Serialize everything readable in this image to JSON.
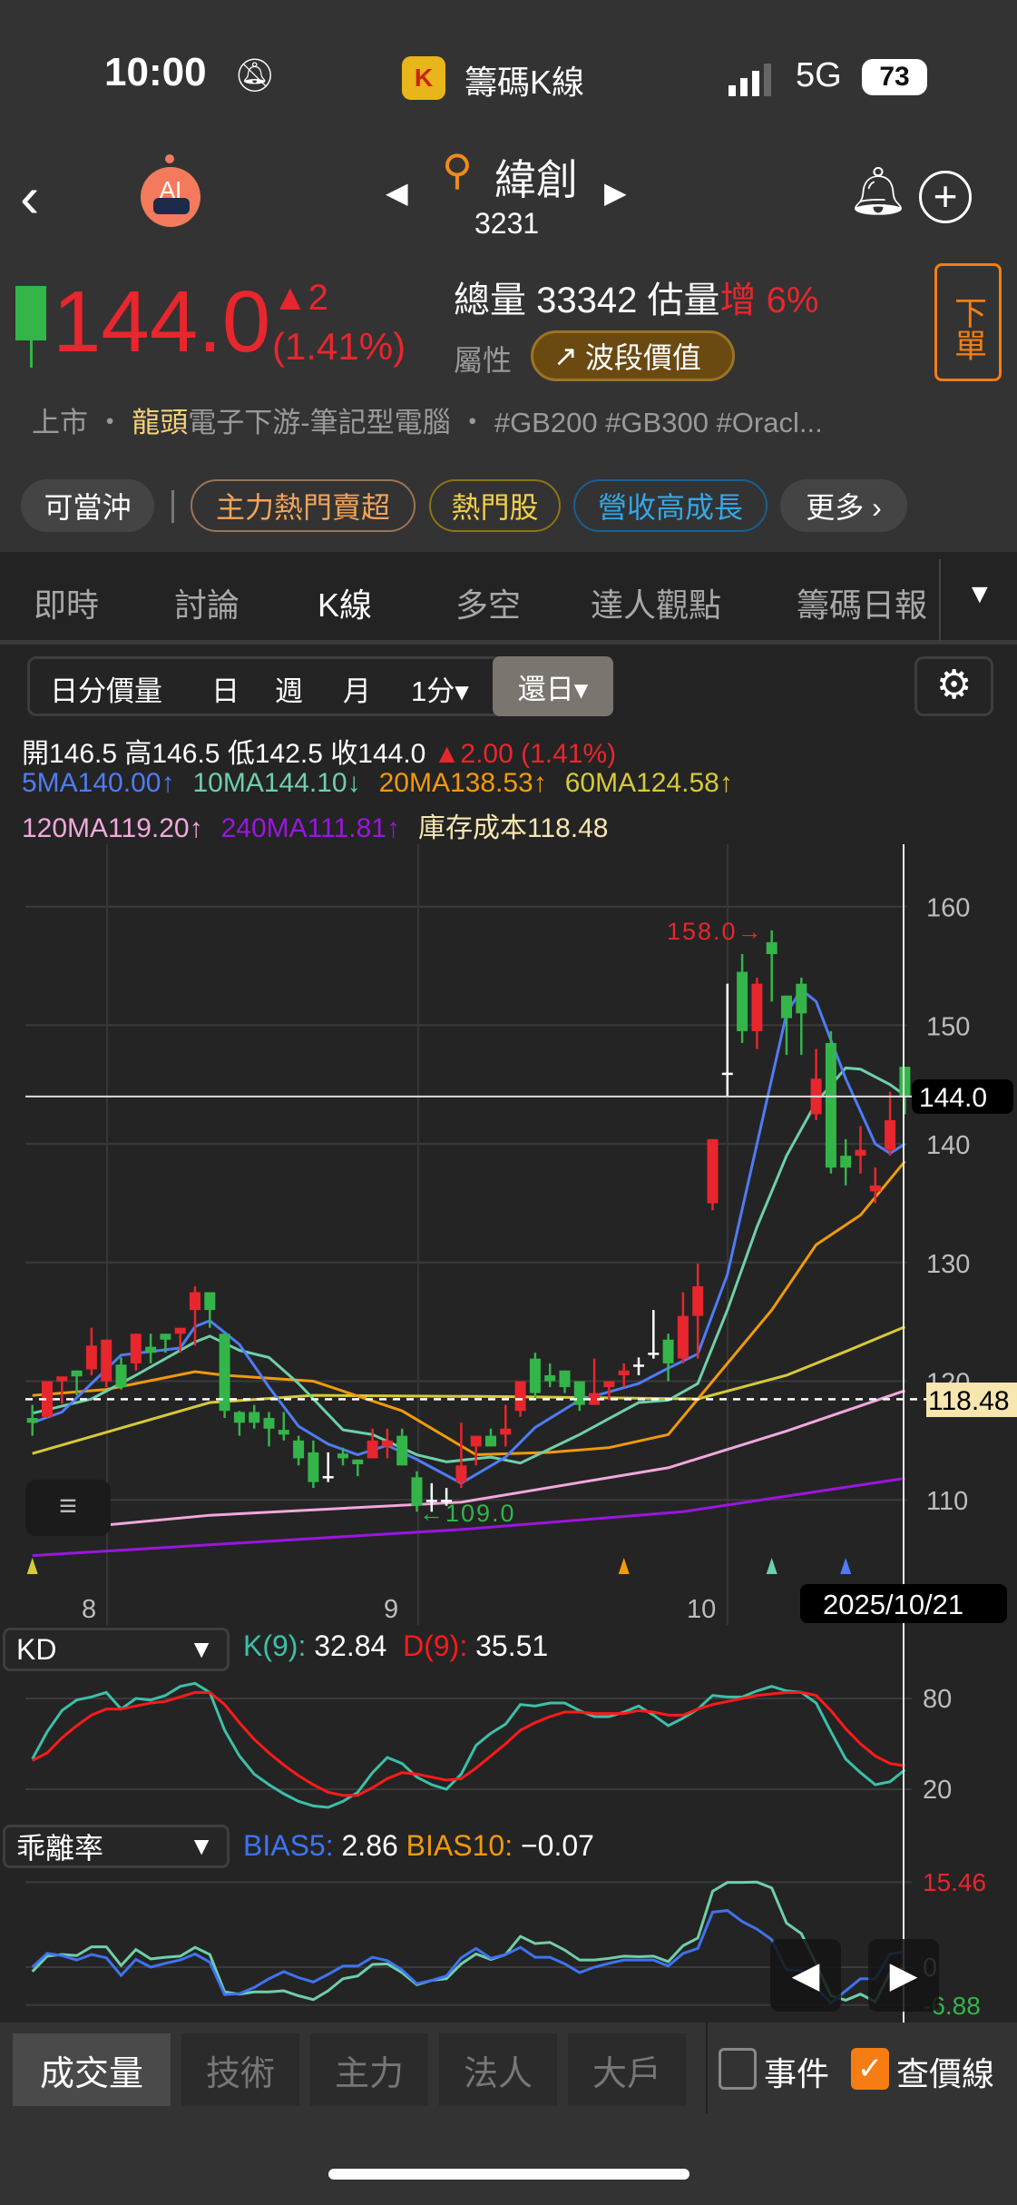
{
  "status_bar": {
    "time": "10:00",
    "app_name": "籌碼K線",
    "network": "5G",
    "battery": "73"
  },
  "header": {
    "stock_name": "緯創",
    "stock_code": "3231",
    "icons": [
      "back-chevron",
      "ai-robot",
      "search",
      "prev-arrow",
      "next-arrow",
      "bell",
      "plus-circle"
    ]
  },
  "quote": {
    "price": "144.0",
    "change": "▲2",
    "change_pct": "(1.41%)",
    "volume_label": "總量",
    "volume": "33342",
    "estimate_label": "估量",
    "estimate_trend": "增",
    "estimate_pct": "6%",
    "attr_label": "屬性",
    "attr_value": "波段價值",
    "order_button": "下單"
  },
  "tags": {
    "market": "上市",
    "dot1": "・",
    "leader": "龍頭",
    "industry": "電子下游-筆記型電腦",
    "dot2": "・",
    "hashtags": "#GB200  #GB300  #Oracl..."
  },
  "chips": [
    {
      "label": "可當沖"
    },
    {
      "label": "主力熱門賣超"
    },
    {
      "label": "熱門股"
    },
    {
      "label": "營收高成長"
    },
    {
      "label": "更多 ›"
    }
  ],
  "tabs": [
    {
      "label": "即時"
    },
    {
      "label": "討論"
    },
    {
      "label": "K線",
      "active": true
    },
    {
      "label": "多空"
    },
    {
      "label": "達人觀點"
    },
    {
      "label": "籌碼日報"
    }
  ],
  "tabs_more": "▼",
  "period": {
    "items": [
      "日分價量",
      "日",
      "週",
      "月",
      "1分▾"
    ],
    "selected": "還日▾"
  },
  "ohlc": {
    "open": "開146.5",
    "high": "高146.5",
    "low": "低142.5",
    "close": "收144.0",
    "change": "▲2.00 (1.41%)"
  },
  "ma_legend": [
    {
      "text": "5MA140.00↑",
      "color": "#4f7cf5"
    },
    {
      "text": "10MA144.10↓",
      "color": "#6fcfa8"
    },
    {
      "text": "20MA138.53↑",
      "color": "#f09a0c"
    },
    {
      "text": "60MA124.58↑",
      "color": "#d6c93a"
    },
    {
      "text": "120MA119.20↑",
      "color": "#f2a8dc"
    },
    {
      "text": "240MA111.81↑",
      "color": "#9a16e0"
    },
    {
      "text": "庫存成本118.48",
      "color": "#f7e6b0"
    }
  ],
  "colors": {
    "up": "#e8262e",
    "down": "#33b54a",
    "ma5": "#4f7cf5",
    "ma10": "#6fcfa8",
    "ma20": "#f09a0c",
    "ma60": "#d6c93a",
    "ma120": "#f2a8dc",
    "ma240": "#9a16e0",
    "k": "#3cc0a8",
    "d": "#ff1a1a",
    "bias5": "#3f73f0",
    "bias10": "#6fcfa8"
  },
  "chart_data": [
    {
      "type": "candlestick",
      "ylim": [
        105,
        163
      ],
      "yticks": [
        110,
        120,
        130,
        140,
        150,
        160
      ],
      "x_month_labels": [
        "8",
        "9",
        "10"
      ],
      "cursor_date": "2025/10/21",
      "last_price_tag": "144.0",
      "cost_line": 118.48,
      "cost_tag": "118.48",
      "high_label": "158.0→",
      "low_label": "←109.0",
      "ohlc": [
        [
          116.9,
          118.0,
          115.4,
          116.5
        ],
        [
          117.0,
          120.0,
          116.9,
          120.0
        ],
        [
          120.0,
          120.4,
          118.1,
          120.4
        ],
        [
          120.9,
          120.9,
          118.8,
          120.4
        ],
        [
          121.0,
          124.5,
          120.5,
          123.0
        ],
        [
          120.0,
          123.5,
          119.5,
          123.5
        ],
        [
          121.4,
          122.0,
          119.3,
          119.5
        ],
        [
          121.5,
          124.0,
          120.9,
          124.0
        ],
        [
          122.9,
          124.0,
          121.5,
          122.4
        ],
        [
          124.0,
          124.0,
          122.4,
          123.5
        ],
        [
          124.0,
          124.5,
          122.4,
          124.5
        ],
        [
          126.0,
          128.0,
          123.0,
          127.5
        ],
        [
          127.5,
          127.5,
          124.5,
          126.0
        ],
        [
          124.0,
          124.0,
          116.9,
          117.5
        ],
        [
          117.4,
          117.5,
          115.4,
          116.5
        ],
        [
          117.4,
          118.0,
          116.0,
          116.5
        ],
        [
          116.9,
          117.4,
          114.5,
          116.0
        ],
        [
          115.9,
          117.4,
          115.0,
          115.5
        ],
        [
          115.0,
          115.4,
          112.9,
          113.5
        ],
        [
          114.0,
          115.0,
          111.0,
          111.5
        ],
        [
          112.0,
          114.0,
          111.5,
          112.0
        ],
        [
          113.9,
          114.4,
          112.9,
          113.5
        ],
        [
          113.4,
          113.4,
          112.0,
          113.0
        ],
        [
          113.5,
          116.0,
          113.5,
          115.0
        ],
        [
          114.5,
          116.0,
          113.5,
          115.0
        ],
        [
          115.4,
          116.0,
          112.9,
          112.9
        ],
        [
          111.9,
          112.4,
          109.0,
          109.5
        ],
        [
          110.0,
          111.4,
          109.0,
          110.0
        ],
        [
          110.0,
          111.0,
          109.5,
          110.0
        ],
        [
          111.5,
          116.5,
          111.0,
          112.9
        ],
        [
          114.5,
          115.4,
          112.9,
          115.4
        ],
        [
          115.4,
          116.0,
          114.5,
          114.5
        ],
        [
          115.5,
          118.0,
          114.5,
          116.0
        ],
        [
          117.5,
          120.0,
          117.0,
          120.0
        ],
        [
          121.9,
          122.4,
          118.4,
          119.0
        ],
        [
          120.5,
          121.5,
          119.5,
          120.0
        ],
        [
          120.9,
          120.9,
          119.0,
          119.5
        ],
        [
          120.0,
          120.0,
          117.5,
          118.0
        ],
        [
          118.0,
          121.9,
          118.0,
          119.0
        ],
        [
          119.5,
          120.0,
          118.4,
          120.0
        ],
        [
          120.5,
          121.5,
          119.5,
          120.9
        ],
        [
          121.4,
          122.0,
          120.5,
          121.4
        ],
        [
          122.4,
          126.0,
          121.9,
          122.4
        ],
        [
          123.5,
          124.0,
          120.0,
          121.5
        ],
        [
          121.9,
          127.5,
          121.5,
          125.5
        ],
        [
          125.5,
          129.9,
          121.9,
          128.0
        ],
        [
          135.0,
          140.4,
          134.4,
          140.4
        ],
        [
          146.0,
          153.5,
          144.0,
          146.0
        ],
        [
          154.5,
          156.0,
          148.5,
          149.5
        ],
        [
          149.5,
          154.0,
          148.0,
          153.5
        ],
        [
          157.0,
          158.0,
          152.0,
          156.0
        ],
        [
          152.5,
          152.5,
          147.5,
          150.6
        ],
        [
          153.5,
          154.0,
          147.5,
          151.0
        ],
        [
          142.5,
          148.0,
          142.0,
          145.5
        ],
        [
          148.5,
          149.5,
          137.5,
          138.0
        ],
        [
          139.0,
          140.4,
          136.5,
          138.0
        ],
        [
          139.0,
          141.5,
          137.5,
          139.5
        ],
        [
          136.0,
          138.0,
          135.0,
          136.5
        ],
        [
          139.5,
          144.4,
          139.0,
          142.0
        ],
        [
          146.5,
          146.5,
          142.5,
          144.0
        ]
      ],
      "ma": {
        "ma5": [
          [
            1,
            116.5
          ],
          [
            3,
            117.4
          ],
          [
            5,
            119.8
          ],
          [
            7,
            122.2
          ],
          [
            11,
            122.8
          ],
          [
            12,
            124.6
          ],
          [
            13,
            125.1
          ],
          [
            15,
            123.1
          ],
          [
            17,
            119.5
          ],
          [
            19,
            116.2
          ],
          [
            21,
            114.7
          ],
          [
            23,
            113.8
          ],
          [
            25,
            114.6
          ],
          [
            27,
            113.4
          ],
          [
            30,
            111.4
          ],
          [
            33,
            113.6
          ],
          [
            35,
            116.1
          ],
          [
            38,
            118.4
          ],
          [
            42,
            119.8
          ],
          [
            44,
            121.1
          ],
          [
            46,
            122.3
          ],
          [
            48,
            129
          ],
          [
            50,
            140
          ],
          [
            52,
            151.0
          ],
          [
            53,
            153.0
          ],
          [
            54,
            152.0
          ],
          [
            56,
            145.5
          ],
          [
            58,
            140.0
          ],
          [
            59,
            139.2
          ],
          [
            60,
            140.0
          ]
        ],
        "ma10": [
          [
            1,
            117.3
          ],
          [
            5,
            118.5
          ],
          [
            8,
            120.5
          ],
          [
            12,
            123.3
          ],
          [
            13,
            123.8
          ],
          [
            15,
            122.6
          ],
          [
            17,
            122.0
          ],
          [
            19,
            119.8
          ],
          [
            22,
            115.9
          ],
          [
            24,
            115.5
          ],
          [
            27,
            113.8
          ],
          [
            29,
            113.2
          ],
          [
            32,
            113.6
          ],
          [
            34,
            113.1
          ],
          [
            38,
            115.5
          ],
          [
            42,
            118.2
          ],
          [
            44,
            118.4
          ],
          [
            46,
            119.8
          ],
          [
            48,
            126
          ],
          [
            50,
            133
          ],
          [
            52,
            139
          ],
          [
            54,
            143.5
          ],
          [
            56,
            146.4
          ],
          [
            57,
            146.3
          ],
          [
            59,
            145.0
          ],
          [
            60,
            144.1
          ]
        ],
        "ma20": [
          [
            1,
            118.8
          ],
          [
            6,
            119.3
          ],
          [
            12,
            120.8
          ],
          [
            14,
            120.5
          ],
          [
            20,
            120.0
          ],
          [
            26,
            117.5
          ],
          [
            31,
            113.8
          ],
          [
            36,
            114.0
          ],
          [
            40,
            114.4
          ],
          [
            44,
            115.5
          ],
          [
            46,
            118.5
          ],
          [
            48,
            121.5
          ],
          [
            51,
            126
          ],
          [
            54,
            131.5
          ],
          [
            57,
            134
          ],
          [
            60,
            138.53
          ]
        ],
        "ma60": [
          [
            1,
            113.9
          ],
          [
            13,
            118.2
          ],
          [
            20,
            118.8
          ],
          [
            33,
            118.7
          ],
          [
            46,
            118.5
          ],
          [
            52,
            120.5
          ],
          [
            56,
            122.5
          ],
          [
            60,
            124.58
          ]
        ],
        "ma120": [
          [
            1,
            107.3
          ],
          [
            13,
            108.7
          ],
          [
            30,
            109.8
          ],
          [
            44,
            112.7
          ],
          [
            52,
            115.8
          ],
          [
            60,
            119.2
          ]
        ],
        "ma240": [
          [
            1,
            105.3
          ],
          [
            30,
            107.5
          ],
          [
            45,
            109.0
          ],
          [
            60,
            111.81
          ]
        ]
      },
      "signals": [
        {
          "candle": 1,
          "color": "#d6c93a"
        },
        {
          "candle": 41,
          "color": "#f09a0c"
        },
        {
          "candle": 51,
          "color": "#6fcfa8"
        },
        {
          "candle": 56,
          "color": "#4f7cf5"
        }
      ]
    },
    {
      "type": "line",
      "indicator": "KD",
      "selector": "KD",
      "k_label": "K(9):",
      "k_value": "32.84",
      "d_label": "D(9):",
      "d_value": "35.51",
      "yticks": [
        "80",
        "20"
      ],
      "k": [
        40,
        58,
        72,
        79,
        81,
        84,
        73,
        80,
        79,
        82,
        88,
        90,
        84,
        59,
        42,
        30,
        23,
        17,
        12,
        9,
        8,
        12,
        18,
        31,
        41,
        37,
        28,
        23,
        20,
        30,
        49,
        57,
        63,
        76,
        75,
        77,
        77,
        72,
        68,
        68,
        71,
        75,
        69,
        62,
        67,
        73,
        82,
        81,
        81,
        85,
        88,
        85,
        84,
        77,
        58,
        40,
        31,
        23,
        25,
        32.84
      ],
      "d": [
        39,
        44,
        54,
        62,
        69,
        73,
        73,
        75,
        77,
        78,
        81,
        84,
        84,
        76,
        64,
        53,
        44,
        36,
        29,
        23,
        18,
        16,
        16,
        21,
        27,
        31,
        30,
        28,
        26,
        27,
        34,
        42,
        50,
        59,
        64,
        68,
        71,
        71,
        70,
        70,
        70,
        72,
        71,
        69,
        69,
        73,
        76,
        78,
        80,
        82,
        83,
        84,
        84,
        82,
        72,
        60,
        50,
        42,
        37,
        35.51
      ]
    },
    {
      "type": "line",
      "indicator": "BIAS",
      "selector": "乖離率",
      "b5_label": "BIAS5:",
      "b5_value": "2.86",
      "b10_label": "BIAS10:",
      "b10_value": "−0.07",
      "ymax": "15.46",
      "ymid": "0",
      "ymin": "-6.88",
      "bias5": [
        0,
        2.5,
        2.1,
        1.3,
        2.3,
        1.7,
        -1.5,
        1.4,
        0,
        0.7,
        1.3,
        2.4,
        0.9,
        -5.0,
        -4.8,
        -3.7,
        -2.1,
        -0.8,
        -1.9,
        -2.7,
        -1.3,
        0.2,
        0.2,
        1.8,
        1.2,
        -0.5,
        -3.0,
        -2.4,
        -1.6,
        1.7,
        3.4,
        1.6,
        2.3,
        3.6,
        1.8,
        1.8,
        0.6,
        -1.0,
        0,
        0.7,
        1.3,
        1.3,
        1.3,
        0.2,
        2.5,
        3.4,
        10.0,
        10.3,
        8.3,
        6.9,
        5.0,
        -0.5,
        -0.6,
        -3.7,
        -6.5,
        -4.3,
        -2.1,
        -2.1,
        2.4,
        2.86
      ],
      "bias10": [
        -0.8,
        2.0,
        2.3,
        2.1,
        3.7,
        3.7,
        0.3,
        3.2,
        1.5,
        1.8,
        2.0,
        3.6,
        2.3,
        -4.5,
        -4.9,
        -4.5,
        -4.5,
        -4.3,
        -5.2,
        -5.9,
        -4.3,
        -2.1,
        -1.6,
        0.5,
        0.6,
        -1.0,
        -3.2,
        -2.4,
        -2.1,
        0.6,
        2.4,
        1.4,
        2.3,
        5.6,
        4.3,
        4.5,
        3.1,
        1.3,
        1.3,
        1.6,
        2.0,
        1.9,
        2.0,
        1.0,
        3.9,
        5.3,
        13.8,
        15.4,
        15.4,
        15.46,
        14.4,
        8.0,
        6.1,
        0.6,
        -5.2,
        -6.0,
        -4.9,
        -6.3,
        -1.0,
        -0.07
      ]
    }
  ],
  "bottom_tabs": [
    {
      "label": "成交量",
      "active": true
    },
    {
      "label": "技術"
    },
    {
      "label": "主力"
    },
    {
      "label": "法人"
    },
    {
      "label": "大戶"
    }
  ],
  "checkboxes": [
    {
      "label": "事件",
      "checked": false
    },
    {
      "label": "查價線",
      "checked": true
    }
  ]
}
